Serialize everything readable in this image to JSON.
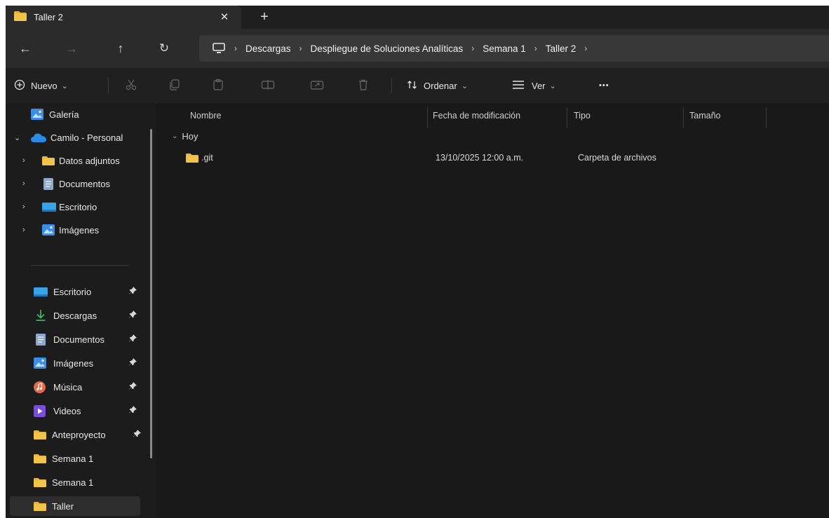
{
  "tab": {
    "title": "Taller 2",
    "close_glyph": "✕",
    "new_glyph": "+"
  },
  "nav": {
    "back": "←",
    "forward": "→",
    "up": "↑",
    "refresh": "↻"
  },
  "breadcrumb": [
    "Descargas",
    "Despliegue de Soluciones Analíticas",
    "Semana 1",
    "Taller 2"
  ],
  "breadcrumb_sep": "›",
  "toolbar": {
    "new_label": "Nuevo",
    "sort_label": "Ordenar",
    "view_label": "Ver",
    "more_label": "•••",
    "dropdown_glyph": "⌄"
  },
  "sidebar": {
    "expand_glyph": "›",
    "collapse_glyph": "⌄",
    "pin_glyph": "📌",
    "top_items": [
      {
        "label": "Galería",
        "icon": "gallery-icon"
      },
      {
        "label": "Camilo - Personal",
        "icon": "onedrive-icon"
      },
      {
        "label": "Datos adjuntos",
        "icon": "folder-icon"
      },
      {
        "label": "Documentos",
        "icon": "documents-icon"
      },
      {
        "label": "Escritorio",
        "icon": "desktop-icon"
      },
      {
        "label": "Imágenes",
        "icon": "pictures-icon"
      }
    ],
    "quick_items": [
      {
        "label": "Escritorio",
        "icon": "desktop-icon"
      },
      {
        "label": "Descargas",
        "icon": "downloads-icon"
      },
      {
        "label": "Documentos",
        "icon": "documents-icon"
      },
      {
        "label": "Imágenes",
        "icon": "pictures-icon"
      },
      {
        "label": "Música",
        "icon": "music-icon"
      },
      {
        "label": "Videos",
        "icon": "videos-icon"
      },
      {
        "label": "Anteproyecto",
        "icon": "folder-icon"
      },
      {
        "label": "Semana 1",
        "icon": "folder-icon"
      },
      {
        "label": "Semana 1",
        "icon": "folder-icon"
      },
      {
        "label": "Taller",
        "icon": "folder-icon"
      }
    ]
  },
  "columns": [
    "Nombre",
    "Fecha de modificación",
    "Tipo",
    "Tamaño"
  ],
  "group": {
    "label": "Hoy",
    "glyph": "⌄"
  },
  "files": [
    {
      "name": ".git",
      "modified": "13/10/2025 12:00 a.m.",
      "type": "Carpeta de archivos",
      "size": ""
    }
  ],
  "colors": {
    "folder": "#e8b63a",
    "accent_blue": "#3b8ee8",
    "background": "#191919"
  }
}
